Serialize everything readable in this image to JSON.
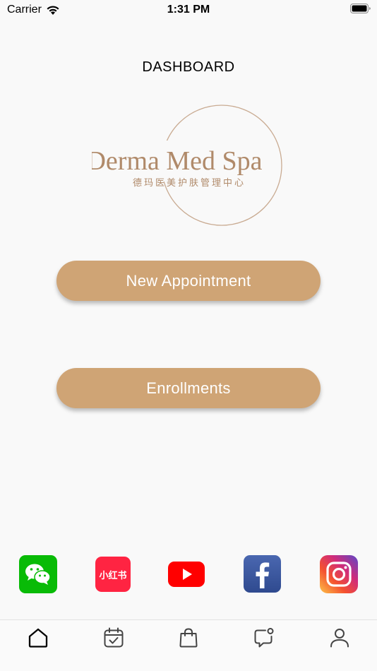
{
  "status_bar": {
    "carrier": "Carrier",
    "time": "1:31 PM",
    "icons": [
      "wifi-icon",
      "battery-icon"
    ]
  },
  "header": {
    "title": "DASHBOARD"
  },
  "logo": {
    "name_text": "Derma Med Spa",
    "chinese_text": "德玛医美护肤管理中心",
    "color": "#b08a6a"
  },
  "actions": {
    "new_appointment_label": "New Appointment",
    "enrollments_label": "Enrollments",
    "button_color": "#cfa475"
  },
  "social_links": [
    {
      "name": "wechat",
      "icon": "wechat-icon",
      "color": "#09bb07"
    },
    {
      "name": "xiaohongshu",
      "icon": "xiaohongshu-icon",
      "label": "小红书",
      "color": "#ff2442"
    },
    {
      "name": "youtube",
      "icon": "youtube-icon",
      "color": "#ff0000"
    },
    {
      "name": "facebook",
      "icon": "facebook-icon",
      "color": "#3b5998"
    },
    {
      "name": "instagram",
      "icon": "instagram-icon",
      "color": "#c13584"
    }
  ],
  "tab_bar": {
    "items": [
      {
        "name": "home",
        "icon": "home-icon",
        "active": true
      },
      {
        "name": "calendar",
        "icon": "calendar-check-icon",
        "active": false
      },
      {
        "name": "shop",
        "icon": "shopping-bag-icon",
        "active": false
      },
      {
        "name": "messages",
        "icon": "chat-notification-icon",
        "active": false
      },
      {
        "name": "profile",
        "icon": "user-icon",
        "active": false
      }
    ]
  }
}
